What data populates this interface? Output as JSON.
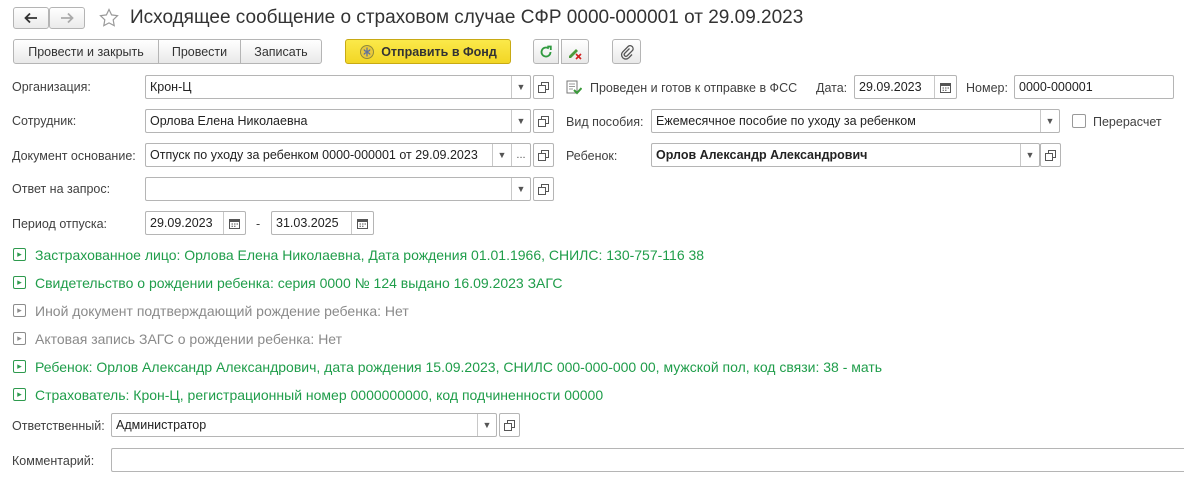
{
  "window": {
    "title": "Исходящее сообщение о страховом случае СФР 0000-000001 от 29.09.2023"
  },
  "nav": {
    "back_icon": "arrow-left-icon",
    "forward_icon": "arrow-right-icon",
    "favorite_icon": "star-icon"
  },
  "toolbar": {
    "post_close": "Провести и закрыть",
    "post": "Провести",
    "save": "Записать",
    "send": "Отправить в Фонд",
    "send_color": "#f7e135",
    "refresh_icon": "refresh-icon",
    "cancel_edit_icon": "pencil-cancel-icon",
    "attach_icon": "paperclip-icon"
  },
  "form": {
    "organization": {
      "label": "Организация:",
      "value": "Крон-Ц"
    },
    "status": "Проведен и готов к отправке в ФСС",
    "date": {
      "label": "Дата:",
      "value": "29.09.2023"
    },
    "number": {
      "label": "Номер:",
      "value": "0000-000001"
    },
    "employee": {
      "label": "Сотрудник:",
      "value": "Орлова Елена Николаевна"
    },
    "benefit_type": {
      "label": "Вид пособия:",
      "value": "Ежемесячное пособие по уходу за ребенком"
    },
    "recalc": {
      "label": "Перерасчет",
      "checked": false
    },
    "basis_doc": {
      "label": "Документ основание:",
      "value": "Отпуск по уходу за ребенком 0000-000001 от 29.09.2023"
    },
    "child": {
      "label": "Ребенок:",
      "value": "Орлов Александр Александрович"
    },
    "reply_to": {
      "label": "Ответ на запрос:",
      "value": ""
    },
    "period": {
      "label": "Период отпуска:",
      "from": "29.09.2023",
      "dash": "-",
      "to": "31.03.2025"
    }
  },
  "sections": [
    {
      "text": "Застрахованное лицо: Орлова Елена Николаевна, Дата рождения 01.01.1966, СНИЛС: 130-757-116 38",
      "state": "filled"
    },
    {
      "text": "Свидетельство о рождении ребенка: серия 0000 № 124 выдано 16.09.2023 ЗАГС",
      "state": "filled"
    },
    {
      "text": "Иной документ подтверждающий рождение ребенка: Нет",
      "state": "empty"
    },
    {
      "text": "Актовая запись ЗАГС о рождении ребенка: Нет",
      "state": "empty"
    },
    {
      "text": "Ребенок: Орлов Александр Александрович, дата рождения 15.09.2023, СНИЛС 000-000-000 00, мужской пол, код связи: 38 - мать",
      "state": "filled"
    },
    {
      "text": "Страхователь: Крон-Ц, регистрационный номер 0000000000, код подчиненности 00000",
      "state": "filled"
    }
  ],
  "footer": {
    "responsible": {
      "label": "Ответственный:",
      "value": "Администратор"
    },
    "comment": {
      "label": "Комментарий:",
      "value": ""
    }
  },
  "colors": {
    "green": "#1f9d4a",
    "gray": "#8a8a8a"
  }
}
